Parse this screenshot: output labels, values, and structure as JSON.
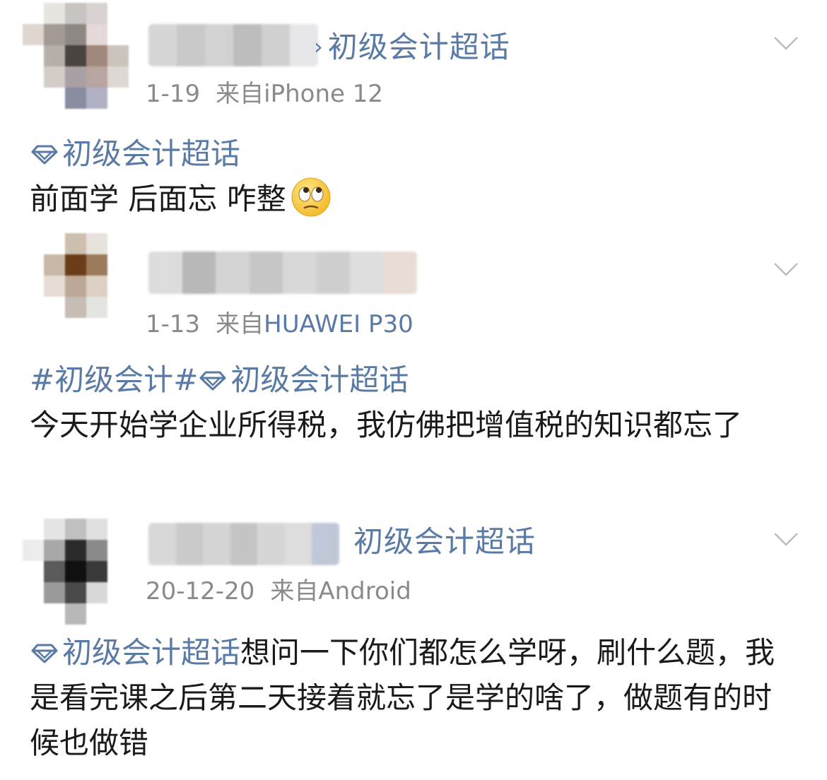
{
  "posts": [
    {
      "topic_header": "初级会计超话",
      "date": "1-19",
      "source_prefix": "来自",
      "device": "iPhone 12",
      "body_topic": "初级会计超话",
      "body_text": "前面学 后面忘 咋整",
      "emoji": "rolling-eyes-emoji"
    },
    {
      "topic_header": "",
      "date": "1-13",
      "source_prefix": "来自",
      "device": "HUAWEI P30",
      "body_hashtag": "#初级会计#",
      "body_topic": "初级会计超话",
      "body_text": "今天开始学企业所得税，我仿佛把增值税的知识都忘了"
    },
    {
      "topic_header": "初级会计超话",
      "date": "20-12-20",
      "source_prefix": "来自",
      "device": "Android",
      "body_topic": "初级会计超话",
      "body_text": "想问一下你们都怎么学呀，刷什么题，我是看完课之后第二天接着就忘了是学的啥了，做题有的时候也做错"
    }
  ],
  "colors": {
    "link_blue": "#5a7aa6",
    "meta_gray": "#8a8a8a",
    "text": "#1a1a1a",
    "chevron": "#bdbdbd"
  }
}
